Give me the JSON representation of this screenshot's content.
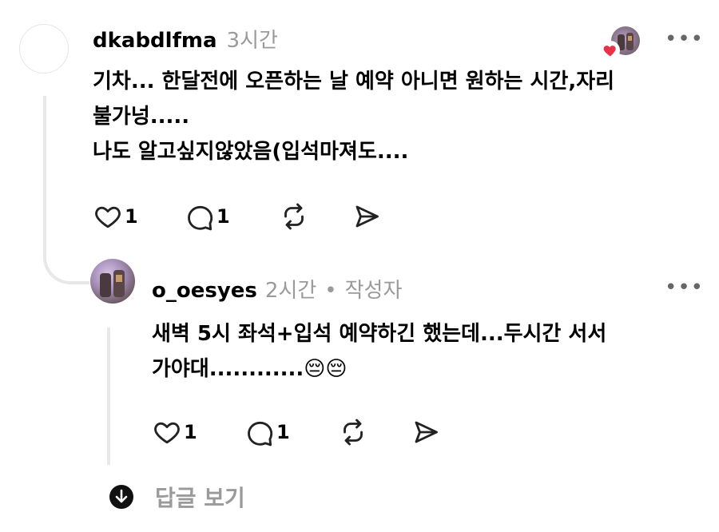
{
  "comment": {
    "username": "dkabdlfma",
    "time": "3시간",
    "text": "기차... 한달전에 오픈하는 날 예약 아니면 원하는 시간,자리\n불가넝.....\n나도 알고싶지않았음(입석마져도....",
    "likes": "1",
    "replies": "1",
    "more": "•••"
  },
  "reply": {
    "username": "o_oesyes",
    "time": "2시간",
    "separator": "•",
    "author_badge": "작성자",
    "text": "새벽 5시 좌석+입석 예약하긴 했는데...두시간 서서\n가야대............",
    "emoji": "😔😔",
    "likes": "1",
    "replies": "1",
    "more": "•••"
  },
  "see_replies": {
    "label": "답글 보기"
  },
  "icons": {
    "like": "heart-outline-icon",
    "comment": "speech-bubble-icon",
    "repost": "repost-arrows-icon",
    "share": "send-icon",
    "more": "more-dots-icon",
    "expand": "arrow-down-circle-icon"
  },
  "colors": {
    "text": "#000000",
    "meta": "#9a9a9a",
    "thread_line": "#e8e8e8",
    "heart_red": "#e8324a"
  }
}
